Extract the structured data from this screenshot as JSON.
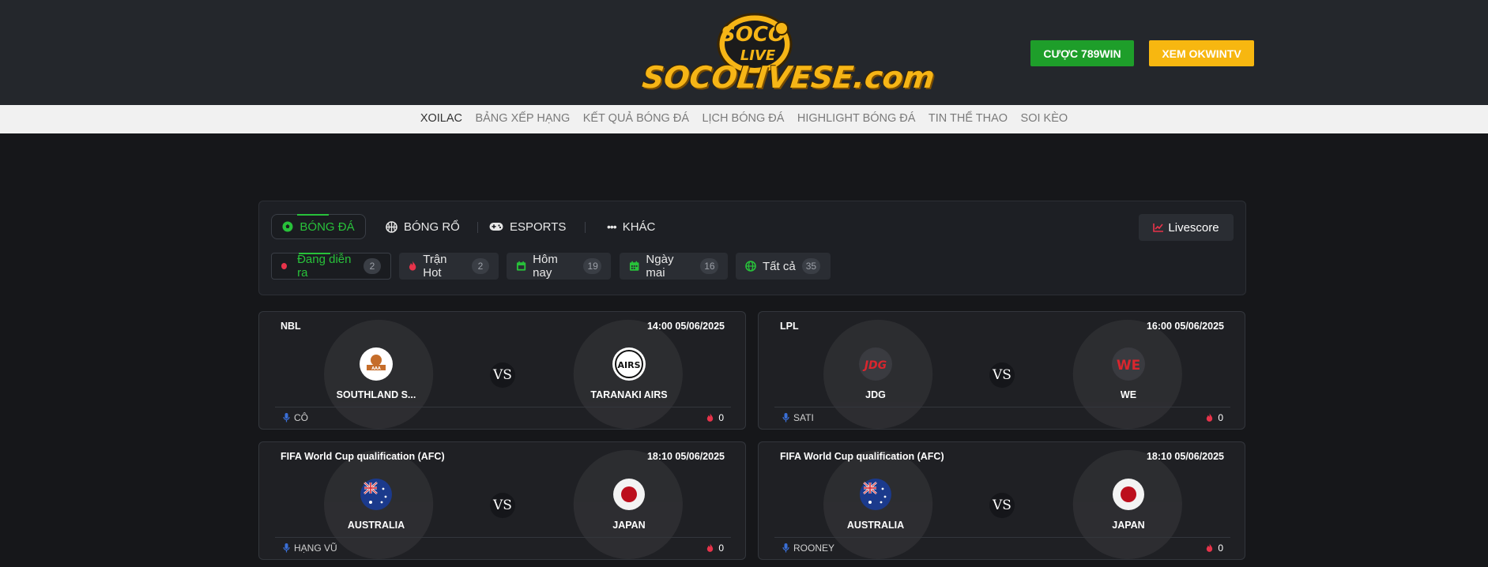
{
  "header": {
    "logo_badge_text": "SOCO LIVE",
    "logo_text": "SOCOLIVESE.com",
    "btn_789": "CƯỢC 789WIN",
    "btn_okwin": "XEM OKWINTV"
  },
  "nav": {
    "items": [
      "XOILAC",
      "BẢNG XẾP HẠNG",
      "KẾT QUẢ BÓNG ĐÁ",
      "LỊCH BÓNG ĐÁ",
      "HIGHLIGHT BÓNG ĐÁ",
      "TIN THỂ THAO",
      "SOI KÈO"
    ]
  },
  "sports": {
    "tabs": [
      "BÓNG ĐÁ",
      "BÓNG RỔ",
      "ESPORTS",
      "KHÁC"
    ],
    "livescore": "Livescore"
  },
  "filters": [
    {
      "label": "Đang diễn ra",
      "count": "2"
    },
    {
      "label": "Trận Hot",
      "count": "2"
    },
    {
      "label": "Hôm nay",
      "count": "19"
    },
    {
      "label": "Ngày mai",
      "count": "16"
    },
    {
      "label": "Tất cả",
      "count": "35"
    }
  ],
  "matches": [
    {
      "league": "NBL",
      "time": "14:00 05/06/2025",
      "home": "SOUTHLAND S...",
      "away": "TARANAKI AIRS",
      "vs": "VS",
      "commentator": "CÔ",
      "viewers": "0"
    },
    {
      "league": "LPL",
      "time": "16:00 05/06/2025",
      "home": "JDG",
      "away": "WE",
      "vs": "VS",
      "commentator": "SATI",
      "viewers": "0"
    },
    {
      "league": "FIFA World Cup qualification (AFC)",
      "time": "18:10 05/06/2025",
      "home": "AUSTRALIA",
      "away": "JAPAN",
      "vs": "VS",
      "commentator": "HẠNG VŨ",
      "viewers": "0"
    },
    {
      "league": "FIFA World Cup qualification (AFC)",
      "time": "18:10 05/06/2025",
      "home": "AUSTRALIA",
      "away": "JAPAN",
      "vs": "VS",
      "commentator": "ROONEY",
      "viewers": "0"
    }
  ],
  "team_logos": {
    "southland": "AAA",
    "taranaki": "AIRS",
    "jdg": "JDG",
    "we": "WE"
  },
  "colors": {
    "accent_green": "#28c13a",
    "button_green": "#1e9e2a",
    "button_yellow": "#f7b710",
    "logo_gold": "#f6b516",
    "live_red": "#e8334a"
  }
}
